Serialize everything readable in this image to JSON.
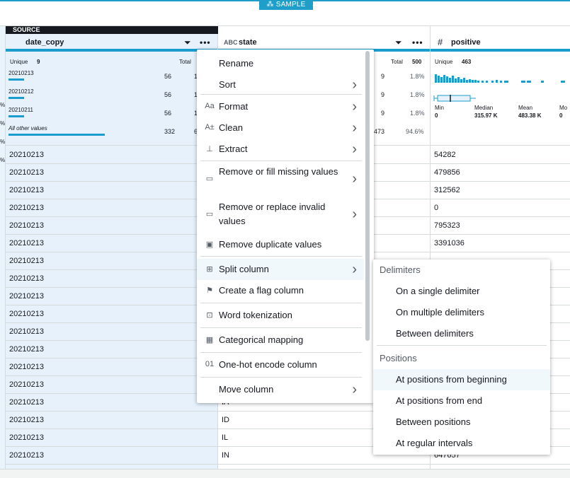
{
  "sample_label": "SAMPLE",
  "source_label": "SOURCE",
  "left_pct_labels": [
    "%",
    "%",
    "%",
    "%"
  ],
  "date_col": {
    "title": "date_copy",
    "unique_label": "Unique",
    "unique_value": "9",
    "total_label": "Total",
    "rows": [
      {
        "value": "20210213",
        "count": "56",
        "extra": "1",
        "fill": 0.1
      },
      {
        "value": "20210212",
        "count": "56",
        "extra": "1",
        "fill": 0.1
      },
      {
        "value": "20210211",
        "count": "56",
        "extra": "1",
        "fill": 0.1
      },
      {
        "value": "All other values",
        "count": "332",
        "extra": "6",
        "fill": 0.62
      }
    ],
    "cells": [
      "20210213",
      "20210213",
      "20210213",
      "20210213",
      "20210213",
      "20210213",
      "20210213",
      "20210213",
      "20210213",
      "20210213",
      "20210213",
      "20210213",
      "20210213",
      "20210213",
      "20210213",
      "20210213",
      "20210213",
      "20210213"
    ]
  },
  "state_col": {
    "type": "ABC",
    "title": "state",
    "total_label": "Total",
    "total_value": "500",
    "rows": [
      {
        "count": "9",
        "pct": "1.8%"
      },
      {
        "count": "9",
        "pct": "1.8%"
      },
      {
        "count": "9",
        "pct": "1.8%"
      },
      {
        "count": "473",
        "pct": "94.6%"
      }
    ],
    "cells_visible": [
      "IA",
      "ID",
      "IL",
      "IN"
    ]
  },
  "pos_col": {
    "type": "#",
    "title": "positive",
    "unique_label": "Unique",
    "unique_value": "463",
    "stats": [
      {
        "label": "Min",
        "value": "0"
      },
      {
        "label": "Median",
        "value": "315.97 K"
      },
      {
        "label": "Mean",
        "value": "483.38 K"
      },
      {
        "label": "Mo",
        "value": "0"
      }
    ],
    "cells": [
      "54282",
      "479856",
      "312562",
      "0",
      "795323",
      "3391036",
      "647657"
    ]
  },
  "menu": {
    "items": [
      {
        "label": "Rename",
        "icon": "",
        "chevron": false
      },
      {
        "label": "Sort",
        "icon": "",
        "chevron": true
      },
      {
        "label": "Format",
        "icon": "Aa",
        "chevron": true
      },
      {
        "label": "Clean",
        "icon": "A±",
        "chevron": true
      },
      {
        "label": "Extract",
        "icon": "⊥",
        "chevron": true
      },
      {
        "label": "Remove or fill missing values",
        "icon": "▭",
        "chevron": true
      },
      {
        "label": "Remove or replace invalid values",
        "icon": "▭",
        "chevron": true
      },
      {
        "label": "Remove duplicate values",
        "icon": "▣",
        "chevron": false
      },
      {
        "label": "Split column",
        "icon": "⊞",
        "chevron": true
      },
      {
        "label": "Create a flag column",
        "icon": "⚑",
        "chevron": false
      },
      {
        "label": "Word tokenization",
        "icon": "⊡",
        "chevron": false
      },
      {
        "label": "Categorical mapping",
        "icon": "▦",
        "chevron": false
      },
      {
        "label": "One-hot encode column",
        "icon": "01",
        "chevron": false
      },
      {
        "label": "Move column",
        "icon": "",
        "chevron": true
      }
    ]
  },
  "submenu": {
    "delimiters_heading": "Delimiters",
    "delimiters": [
      "On a single delimiter",
      "On multiple delimiters",
      "Between delimiters"
    ],
    "positions_heading": "Positions",
    "positions": [
      "At positions from beginning",
      "At positions from end",
      "Between positions",
      "At regular intervals"
    ]
  }
}
